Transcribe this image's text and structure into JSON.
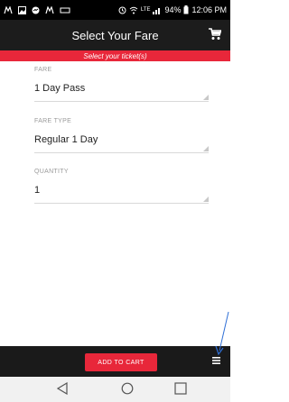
{
  "status_bar": {
    "battery": "94%",
    "time": "12:06 PM",
    "network": "LTE"
  },
  "app_bar": {
    "title": "Select Your Fare"
  },
  "banner": {
    "text": "Select your ticket(s)"
  },
  "form": {
    "fare": {
      "label": "FARE",
      "value": "1 Day Pass"
    },
    "fare_type": {
      "label": "FARE TYPE",
      "value": "Regular 1 Day"
    },
    "quantity": {
      "label": "QUANTITY",
      "value": "1"
    }
  },
  "bottom_bar": {
    "add_to_cart_label": "ADD TO CART"
  },
  "colors": {
    "accent": "#e8273a",
    "app_bar": "#1c1c1c",
    "annotation_arrow": "#2f6fd6"
  },
  "icons": [
    "cart-icon",
    "menu-icon",
    "back-icon",
    "home-icon",
    "recents-icon",
    "messenger-icon",
    "gallery-icon",
    "wifi-icon",
    "signal-icon",
    "battery-icon"
  ]
}
